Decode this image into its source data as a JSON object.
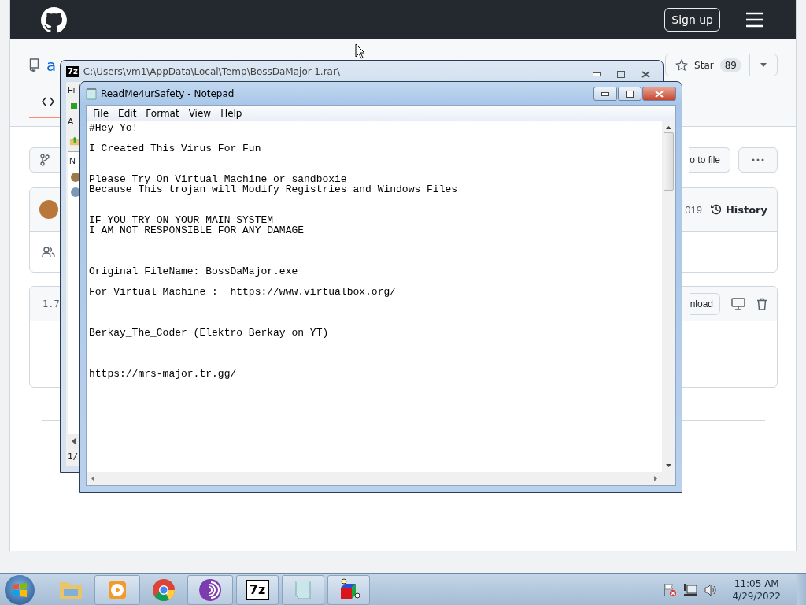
{
  "browser": {
    "header": {
      "sign_up": "Sign up"
    },
    "repo": {
      "name": "a",
      "star": {
        "label": "Star",
        "count": "89"
      }
    },
    "tabs": [
      {
        "selected": true
      }
    ],
    "file_actions": {
      "go_to_file": "o to file"
    },
    "commit": {
      "date": "019",
      "history": "History"
    },
    "file": {
      "version": "1.7",
      "download": "nload"
    }
  },
  "archive_window": {
    "icon_label": "7z",
    "title": "C:\\Users\\vm1\\AppData\\Local\\Temp\\BossDaMajor-1.rar\\",
    "active": false,
    "menu": "Fi",
    "toolbar_label": "A",
    "column": "N",
    "status": "1/"
  },
  "notepad": {
    "title": "ReadMe4urSafety - Notepad",
    "active": true,
    "menu": [
      "File",
      "Edit",
      "Format",
      "View",
      "Help"
    ],
    "text": "#Hey Yo!\n\nI Created This Virus For Fun\n\n\nPlease Try On Virtual Machine or sandboxie\nBecause This trojan will Modify Registries and Windows Files\n\n\nIF YOU TRY ON YOUR MAIN SYSTEM\nI AM NOT RESPONSIBLE FOR ANY DAMAGE\n\n\n\nOriginal FileName: BossDaMajor.exe\n\nFor Virtual Machine :  https://www.virtualbox.org/\n\n\n\nBerkay_The_Coder (Elektro Berkay on YT)\n\n\n\nhttps://mrs-major.tr.gg/"
  },
  "taskbar": {
    "apps": [
      {
        "kind": "explorer",
        "running": false
      },
      {
        "kind": "media",
        "running": true
      },
      {
        "kind": "chrome",
        "running": false
      },
      {
        "kind": "tor",
        "running": true
      },
      {
        "kind": "sevenzip",
        "running": true,
        "label": "7z"
      },
      {
        "kind": "notepad",
        "running": true
      },
      {
        "kind": "cube",
        "running": true
      }
    ],
    "clock": {
      "time": "11:05 AM",
      "date": "4/29/2022"
    }
  }
}
